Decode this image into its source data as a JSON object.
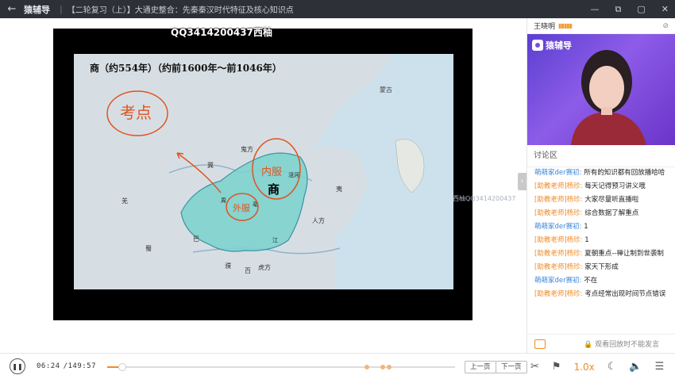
{
  "topbar": {
    "back_icon": "arrow-left-icon",
    "brand": "猿辅导",
    "title": "【二轮复习（上）】大通史整合：先秦秦汉时代特征及核心知识点",
    "window_buttons": [
      "—",
      "⧉",
      "▢",
      "✕"
    ]
  },
  "watermark": {
    "top": "QQ3414200437西柚",
    "side": "西柚QQ3414200437"
  },
  "slide": {
    "title": "商（约554年）（约前1600年～前1046年）",
    "map_labels": {
      "shang": "商",
      "mengu": "蒙古",
      "bo": "亳",
      "gui": "鬼方",
      "qiang": "羌",
      "ba": "巴",
      "shu": "蜀",
      "pu": "濮",
      "bai": "百",
      "jiang": "江",
      "renfang": "人方",
      "yi": "夷",
      "huhe": "沮河",
      "ji": "冀",
      "hu": "虎方",
      "zhou": "周"
    },
    "annotations": {
      "kaodian": "考点",
      "neifu": "内服",
      "waifu": "外服"
    }
  },
  "right_panel": {
    "teacher_name": "王晓明",
    "signal_icon": "signal-icon",
    "mic_icon": "mic-off-icon",
    "cam_logo": "猿辅导",
    "discuss_title": "讨论区",
    "messages": [
      {
        "who": "萌萌家der赛初:",
        "role": "s",
        "text": "所有的知识都有回放播哈哈"
      },
      {
        "who": "[助教老师]杨珍:",
        "role": "t",
        "text": "每天记得预习讲义哦"
      },
      {
        "who": "[助教老师]杨珍:",
        "role": "t",
        "text": "大家尽量听直播啦"
      },
      {
        "who": "[助教老师]杨珍:",
        "role": "t",
        "text": "综合数据了解重点"
      },
      {
        "who": "萌萌家der赛初:",
        "role": "s",
        "text": "1"
      },
      {
        "who": "[助教老师]杨珍:",
        "role": "t",
        "text": "1"
      },
      {
        "who": "[助教老师]杨珍:",
        "role": "t",
        "text": "夏朝重点--禅让制到世袭制"
      },
      {
        "who": "[助教老师]杨珍:",
        "role": "t",
        "text": "家天下形成"
      },
      {
        "who": "萌萌家der赛初:",
        "role": "s",
        "text": "不在"
      },
      {
        "who": "[助教老师]杨珍:",
        "role": "t",
        "text": "考点经常出现时间节点错误"
      }
    ],
    "footer_note": "观看回放时不能发言"
  },
  "controls": {
    "time_current": "06:24",
    "time_total": "/149:57",
    "prev_page": "上一页",
    "next_page": "下一页",
    "progress_fraction": 0.043,
    "speed": "1.0x",
    "icons": [
      "scissors-icon",
      "flag-icon",
      "moon-icon",
      "volume-icon",
      "menu-icon"
    ]
  }
}
